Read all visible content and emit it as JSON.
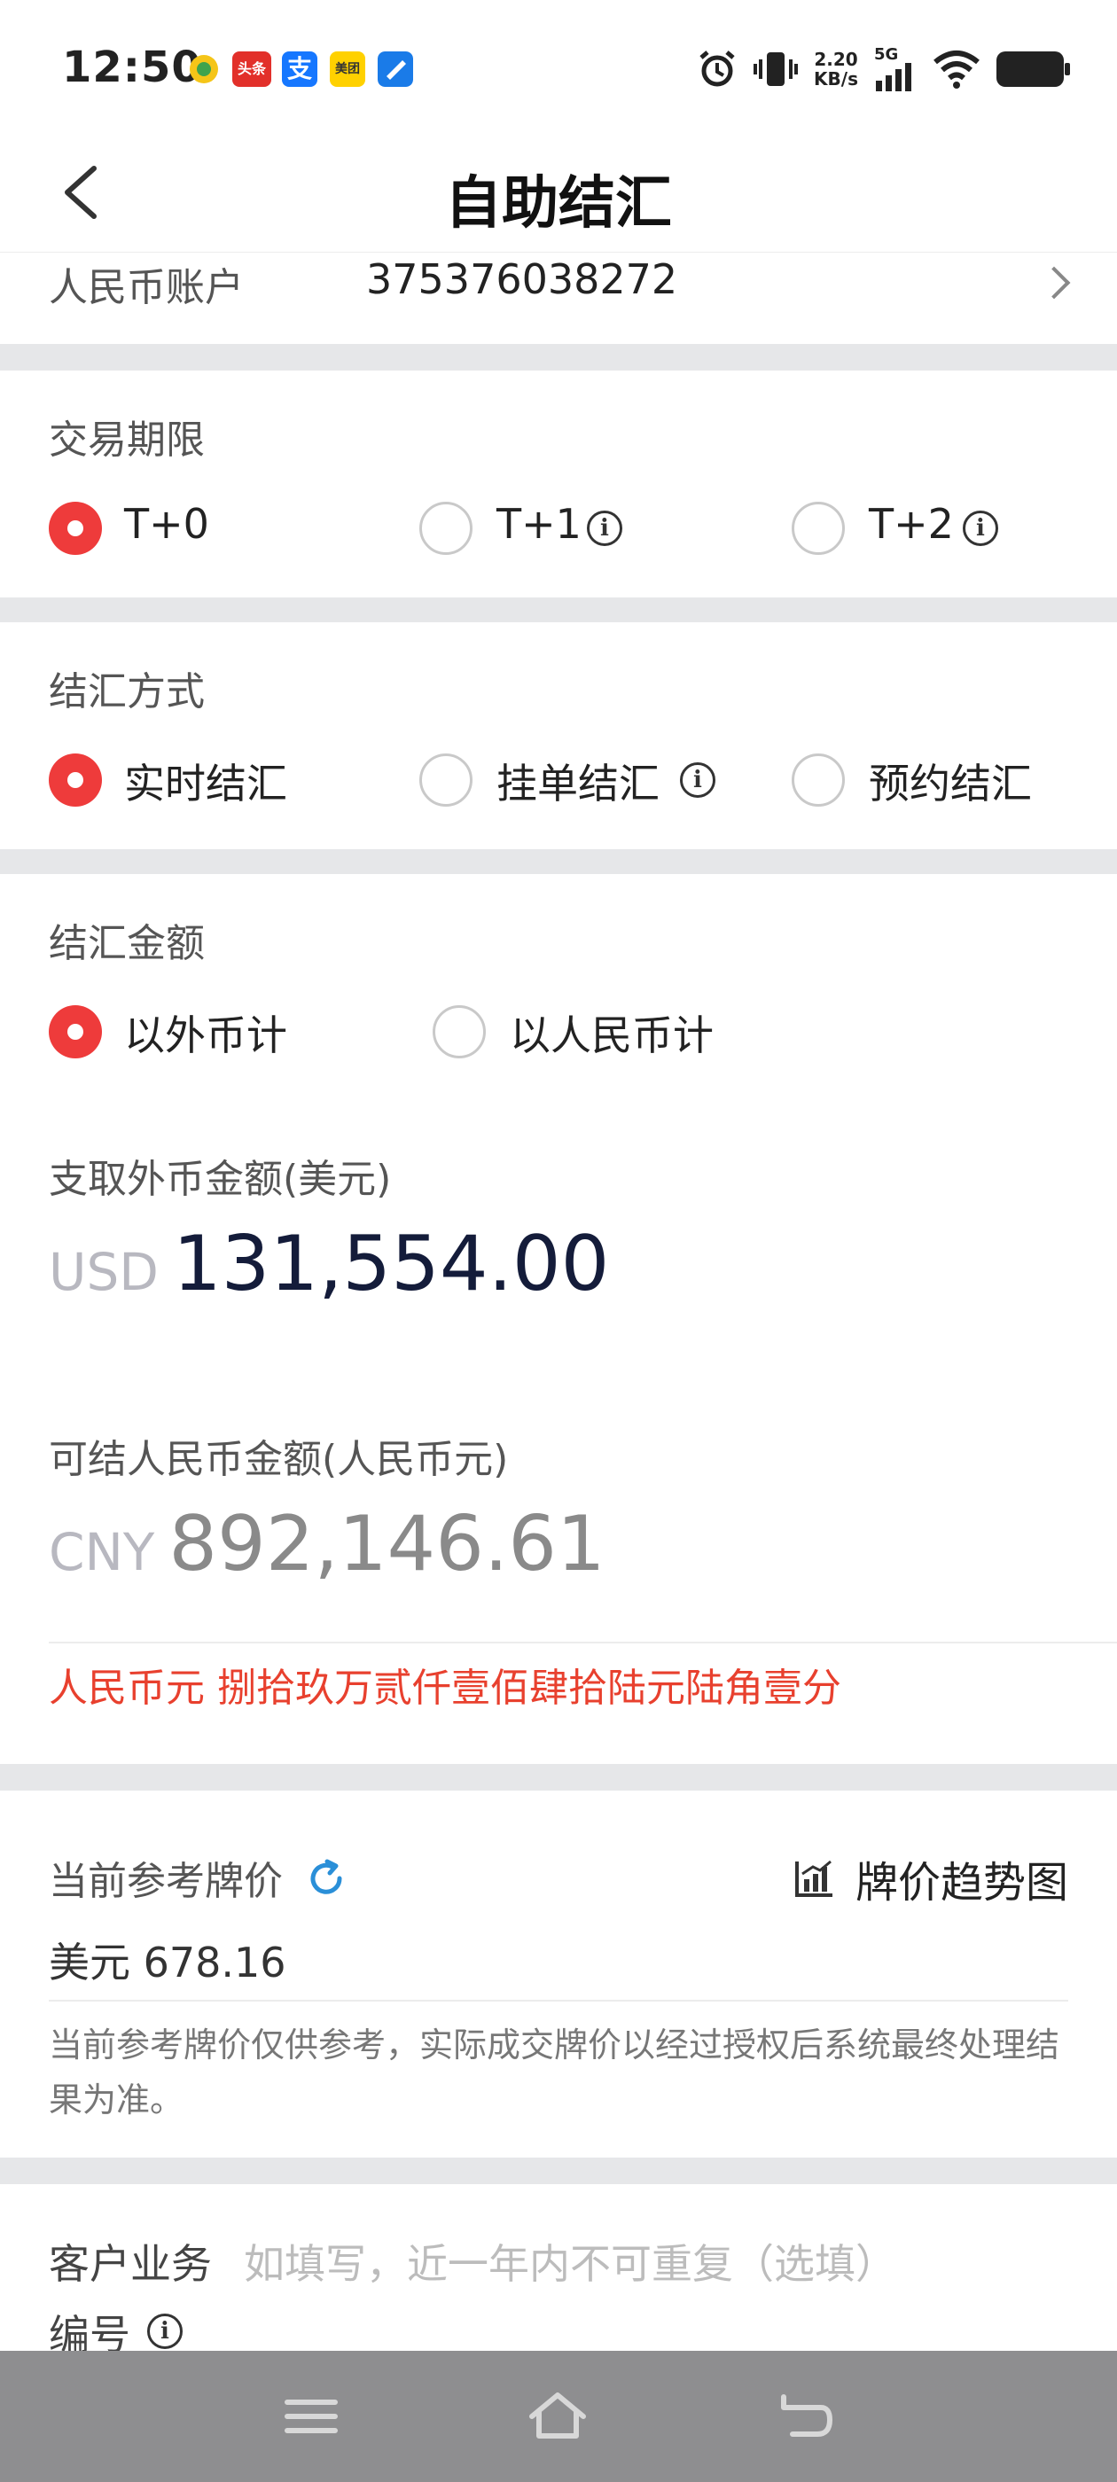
{
  "status_bar": {
    "time": "12:50",
    "net_speed_value": "2.20",
    "net_speed_unit": "KB/s",
    "network": "5G",
    "notification_icons": [
      "lottery-app-icon",
      "toutiao-app-icon",
      "alipay-app-icon",
      "meituan-app-icon",
      "bank-app-icon"
    ],
    "notification_labels": {
      "toutiao": "头条",
      "alipay": "支",
      "meituan": "美团"
    }
  },
  "header": {
    "title": "自助结汇",
    "back_icon": "chevron-left-icon"
  },
  "account": {
    "label": "人民币账户",
    "number": "375376038272"
  },
  "term": {
    "label": "交易期限",
    "options": [
      {
        "label": "T+0",
        "selected": true,
        "info": false
      },
      {
        "label": "T+1",
        "selected": false,
        "info": true
      },
      {
        "label": "T+2",
        "selected": false,
        "info": true
      }
    ]
  },
  "method": {
    "label": "结汇方式",
    "options": [
      {
        "label": "实时结汇",
        "selected": true,
        "info": false
      },
      {
        "label": "挂单结汇",
        "selected": false,
        "info": true
      },
      {
        "label": "预约结汇",
        "selected": false,
        "info": false
      }
    ]
  },
  "amount_mode": {
    "label": "结汇金额",
    "options": [
      {
        "label": "以外币计",
        "selected": true
      },
      {
        "label": "以人民币计",
        "selected": false
      }
    ]
  },
  "foreign": {
    "label": "支取外币金额(美元)",
    "currency": "USD",
    "amount": "131,554.00"
  },
  "cny": {
    "label": "可结人民币金额(人民币元)",
    "currency": "CNY",
    "amount": "892,146.61",
    "capital": "人民币元 捌拾玖万贰仟壹佰肆拾陆元陆角壹分"
  },
  "rate": {
    "label": "当前参考牌价",
    "trend_label": "牌价趋势图",
    "value": "美元 678.16",
    "note": "当前参考牌价仅供参考，实际成交牌价以经过授权后系统最终处理结果为准。"
  },
  "customer": {
    "label_line1": "客户业务",
    "label_line2": "编号",
    "placeholder": "如填写，近一年内不可重复（选填）"
  },
  "colors": {
    "accent_red": "#ee3b3b",
    "capital_red": "#e8402e",
    "refresh_blue": "#2a8fd8",
    "section_gap": "#e6e7e9",
    "navbar": "#8e8e90"
  }
}
